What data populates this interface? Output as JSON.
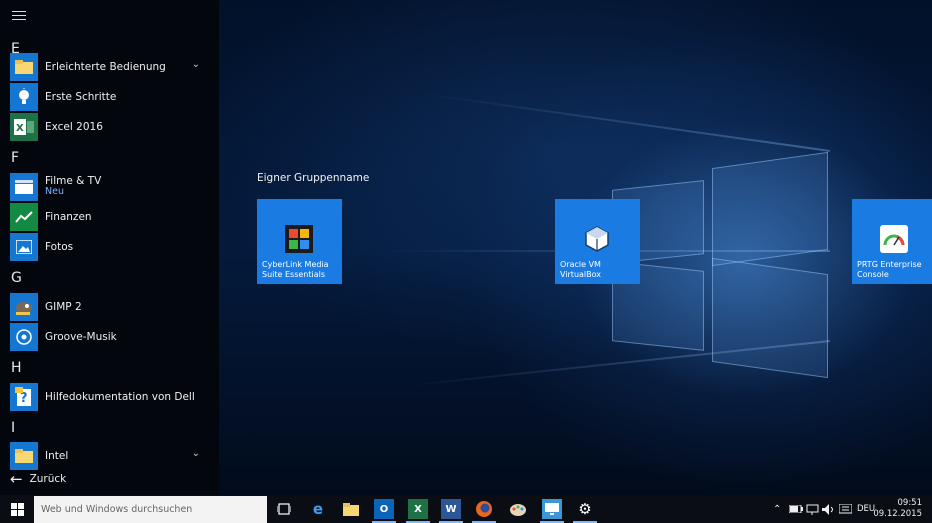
{
  "start_menu": {
    "sections": [
      {
        "letter": "E"
      },
      {
        "letter": "F"
      },
      {
        "letter": "G"
      },
      {
        "letter": "H"
      },
      {
        "letter": "I"
      }
    ],
    "apps": [
      {
        "label": "Erleichterte Bedienung",
        "icon": "folder-icon",
        "expandable": true
      },
      {
        "label": "Erste Schritte",
        "icon": "lightbulb-icon"
      },
      {
        "label": "Excel 2016",
        "icon": "excel-icon"
      },
      {
        "label": "Filme & TV",
        "sub": "Neu",
        "icon": "film-icon"
      },
      {
        "label": "Finanzen",
        "icon": "chart-icon"
      },
      {
        "label": "Fotos",
        "icon": "photo-icon"
      },
      {
        "label": "GIMP 2",
        "icon": "gimp-icon"
      },
      {
        "label": "Groove-Musik",
        "icon": "music-disc-icon"
      },
      {
        "label": "Hilfedokumentation von Dell",
        "icon": "help-doc-icon"
      },
      {
        "label": "Intel",
        "icon": "folder-icon",
        "expandable": true
      }
    ],
    "back_label": "Zurück"
  },
  "tiles": {
    "group_name": "Eigner Gruppenname",
    "items": [
      {
        "line1": "CyberLink Media",
        "line2": "Suite Essentials",
        "icon": "cyberlink-icon"
      },
      {
        "line1": "Oracle VM",
        "line2": "VirtualBox",
        "icon": "virtualbox-icon"
      },
      {
        "line1": "PRTG Enterprise",
        "line2": "Console",
        "icon": "prtg-gauge-icon"
      }
    ]
  },
  "taskbar": {
    "search_placeholder": "Web und Windows durchsuchen",
    "pinned": [
      "task-view-icon",
      "edge-icon",
      "explorer-icon",
      "outlook-icon",
      "excel-icon",
      "word-icon",
      "firefox-icon",
      "paint-icon",
      "remote-desktop-icon",
      "settings-icon"
    ],
    "tray": {
      "language": "DEU",
      "time": "09:51",
      "date": "09.12.2015"
    }
  },
  "colors": {
    "accent": "#1a7ce3",
    "start_bg": "#03060c",
    "taskbar_bg": "#0a0e14",
    "sub_text": "#7fb4ff"
  }
}
